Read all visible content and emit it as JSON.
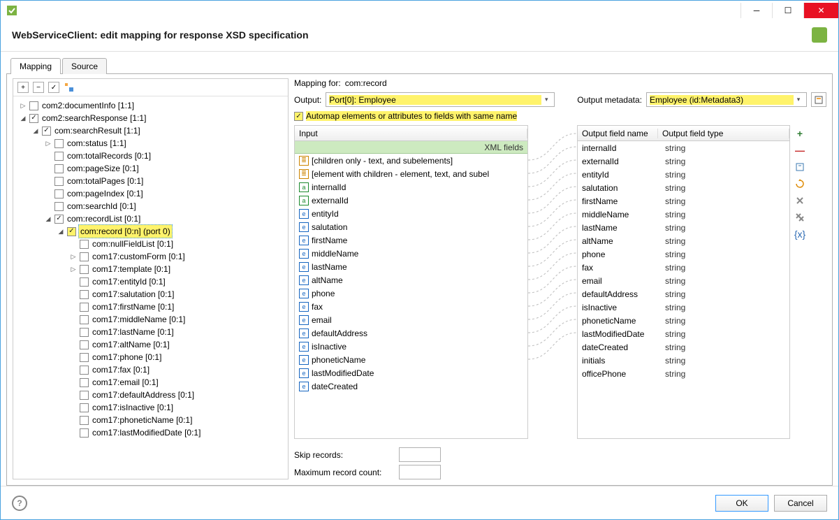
{
  "window": {
    "title": "WebServiceClient: edit mapping for response XSD specification"
  },
  "tabs": {
    "mapping": "Mapping",
    "source": "Source"
  },
  "tree": [
    {
      "d": 0,
      "exp": "▷",
      "chk": false,
      "label": "com2:documentInfo [1:1]"
    },
    {
      "d": 0,
      "exp": "◢",
      "chk": true,
      "label": "com2:searchResponse [1:1]"
    },
    {
      "d": 1,
      "exp": "◢",
      "chk": true,
      "label": "com:searchResult [1:1]"
    },
    {
      "d": 2,
      "exp": "▷",
      "chk": false,
      "label": "com:status [1:1]"
    },
    {
      "d": 2,
      "exp": "",
      "chk": false,
      "label": "com:totalRecords [0:1]"
    },
    {
      "d": 2,
      "exp": "",
      "chk": false,
      "label": "com:pageSize [0:1]"
    },
    {
      "d": 2,
      "exp": "",
      "chk": false,
      "label": "com:totalPages [0:1]"
    },
    {
      "d": 2,
      "exp": "",
      "chk": false,
      "label": "com:pageIndex [0:1]"
    },
    {
      "d": 2,
      "exp": "",
      "chk": false,
      "label": "com:searchId [0:1]"
    },
    {
      "d": 2,
      "exp": "◢",
      "chk": true,
      "label": "com:recordList [0:1]"
    },
    {
      "d": 3,
      "exp": "◢",
      "chk": true,
      "label": "com:record [0:n] (port 0)",
      "sel": true,
      "hl": true
    },
    {
      "d": 4,
      "exp": "",
      "chk": false,
      "label": "com:nullFieldList [0:1]"
    },
    {
      "d": 4,
      "exp": "▷",
      "chk": false,
      "label": "com17:customForm [0:1]"
    },
    {
      "d": 4,
      "exp": "▷",
      "chk": false,
      "label": "com17:template [0:1]"
    },
    {
      "d": 4,
      "exp": "",
      "chk": false,
      "label": "com17:entityId [0:1]"
    },
    {
      "d": 4,
      "exp": "",
      "chk": false,
      "label": "com17:salutation [0:1]"
    },
    {
      "d": 4,
      "exp": "",
      "chk": false,
      "label": "com17:firstName [0:1]"
    },
    {
      "d": 4,
      "exp": "",
      "chk": false,
      "label": "com17:middleName [0:1]"
    },
    {
      "d": 4,
      "exp": "",
      "chk": false,
      "label": "com17:lastName [0:1]"
    },
    {
      "d": 4,
      "exp": "",
      "chk": false,
      "label": "com17:altName [0:1]"
    },
    {
      "d": 4,
      "exp": "",
      "chk": false,
      "label": "com17:phone [0:1]"
    },
    {
      "d": 4,
      "exp": "",
      "chk": false,
      "label": "com17:fax [0:1]"
    },
    {
      "d": 4,
      "exp": "",
      "chk": false,
      "label": "com17:email [0:1]"
    },
    {
      "d": 4,
      "exp": "",
      "chk": false,
      "label": "com17:defaultAddress [0:1]"
    },
    {
      "d": 4,
      "exp": "",
      "chk": false,
      "label": "com17:isInactive [0:1]"
    },
    {
      "d": 4,
      "exp": "",
      "chk": false,
      "label": "com17:phoneticName [0:1]"
    },
    {
      "d": 4,
      "exp": "",
      "chk": false,
      "label": "com17:lastModifiedDate [0:1]"
    }
  ],
  "mapping_header": {
    "mapping_for_label": "Mapping for:",
    "mapping_for_value": "com:record",
    "output_label": "Output:",
    "output_value": "Port[0]: Employee",
    "metadata_label": "Output metadata:",
    "metadata_value": "Employee (id:Metadata3)",
    "automap_label": "Automap elements or attributes to fields with same name",
    "automap_checked": true
  },
  "input": {
    "header": "Input",
    "xml_band": "XML fields",
    "rows": [
      {
        "ico": "t",
        "label": "[children only - text, and subelements]"
      },
      {
        "ico": "t",
        "label": "[element with children - element, text, and subel"
      },
      {
        "ico": "a",
        "label": "internalId"
      },
      {
        "ico": "a",
        "label": "externalId"
      },
      {
        "ico": "e",
        "label": "entityId"
      },
      {
        "ico": "e",
        "label": "salutation"
      },
      {
        "ico": "e",
        "label": "firstName"
      },
      {
        "ico": "e",
        "label": "middleName"
      },
      {
        "ico": "e",
        "label": "lastName"
      },
      {
        "ico": "e",
        "label": "altName"
      },
      {
        "ico": "e",
        "label": "phone"
      },
      {
        "ico": "e",
        "label": "fax"
      },
      {
        "ico": "e",
        "label": "email"
      },
      {
        "ico": "e",
        "label": "defaultAddress"
      },
      {
        "ico": "e",
        "label": "isInactive"
      },
      {
        "ico": "e",
        "label": "phoneticName"
      },
      {
        "ico": "e",
        "label": "lastModifiedDate"
      },
      {
        "ico": "e",
        "label": "dateCreated"
      }
    ]
  },
  "output": {
    "headers": {
      "name": "Output field name",
      "type": "Output field type"
    },
    "rows": [
      {
        "name": "internalId",
        "type": "string"
      },
      {
        "name": "externalId",
        "type": "string"
      },
      {
        "name": "entityId",
        "type": "string"
      },
      {
        "name": "salutation",
        "type": "string"
      },
      {
        "name": "firstName",
        "type": "string"
      },
      {
        "name": "middleName",
        "type": "string"
      },
      {
        "name": "lastName",
        "type": "string"
      },
      {
        "name": "altName",
        "type": "string"
      },
      {
        "name": "phone",
        "type": "string"
      },
      {
        "name": "fax",
        "type": "string"
      },
      {
        "name": "email",
        "type": "string"
      },
      {
        "name": "defaultAddress",
        "type": "string"
      },
      {
        "name": "isInactive",
        "type": "string"
      },
      {
        "name": "phoneticName",
        "type": "string"
      },
      {
        "name": "lastModifiedDate",
        "type": "string"
      },
      {
        "name": "dateCreated",
        "type": "string"
      },
      {
        "name": "initials",
        "type": "string"
      },
      {
        "name": "officePhone",
        "type": "string"
      }
    ]
  },
  "bottom": {
    "skip_label": "Skip records:",
    "max_label": "Maximum record count:"
  },
  "footer": {
    "ok": "OK",
    "cancel": "Cancel"
  }
}
